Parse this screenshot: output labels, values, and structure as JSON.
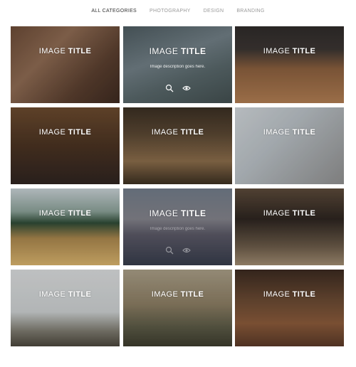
{
  "filters": [
    {
      "label": "ALL CATEGORIES",
      "active": true
    },
    {
      "label": "PHOTOGRAPHY",
      "active": false
    },
    {
      "label": "DESIGN",
      "active": false
    },
    {
      "label": "BRANDING",
      "active": false
    }
  ],
  "tiles": [
    {
      "title_light": "IMAGE",
      "title_bold": "TITLE"
    },
    {
      "title_light": "IMAGE",
      "title_bold": "TITLE",
      "description": "Image description goes here."
    },
    {
      "title_light": "IMAGE",
      "title_bold": "TITLE"
    },
    {
      "title_light": "IMAGE",
      "title_bold": "TITLE"
    },
    {
      "title_light": "IMAGE",
      "title_bold": "TITLE"
    },
    {
      "title_light": "IMAGE",
      "title_bold": "TITLE"
    },
    {
      "title_light": "IMAGE",
      "title_bold": "TITLE"
    },
    {
      "title_light": "IMAGE",
      "title_bold": "TITLE",
      "description": "Image description goes here."
    },
    {
      "title_light": "IMAGE",
      "title_bold": "TITLE"
    },
    {
      "title_light": "IMAGE",
      "title_bold": "TITLE"
    },
    {
      "title_light": "IMAGE",
      "title_bold": "TITLE"
    },
    {
      "title_light": "IMAGE",
      "title_bold": "TITLE"
    }
  ],
  "icons": {
    "zoom": "search-icon",
    "view": "eye-icon"
  }
}
